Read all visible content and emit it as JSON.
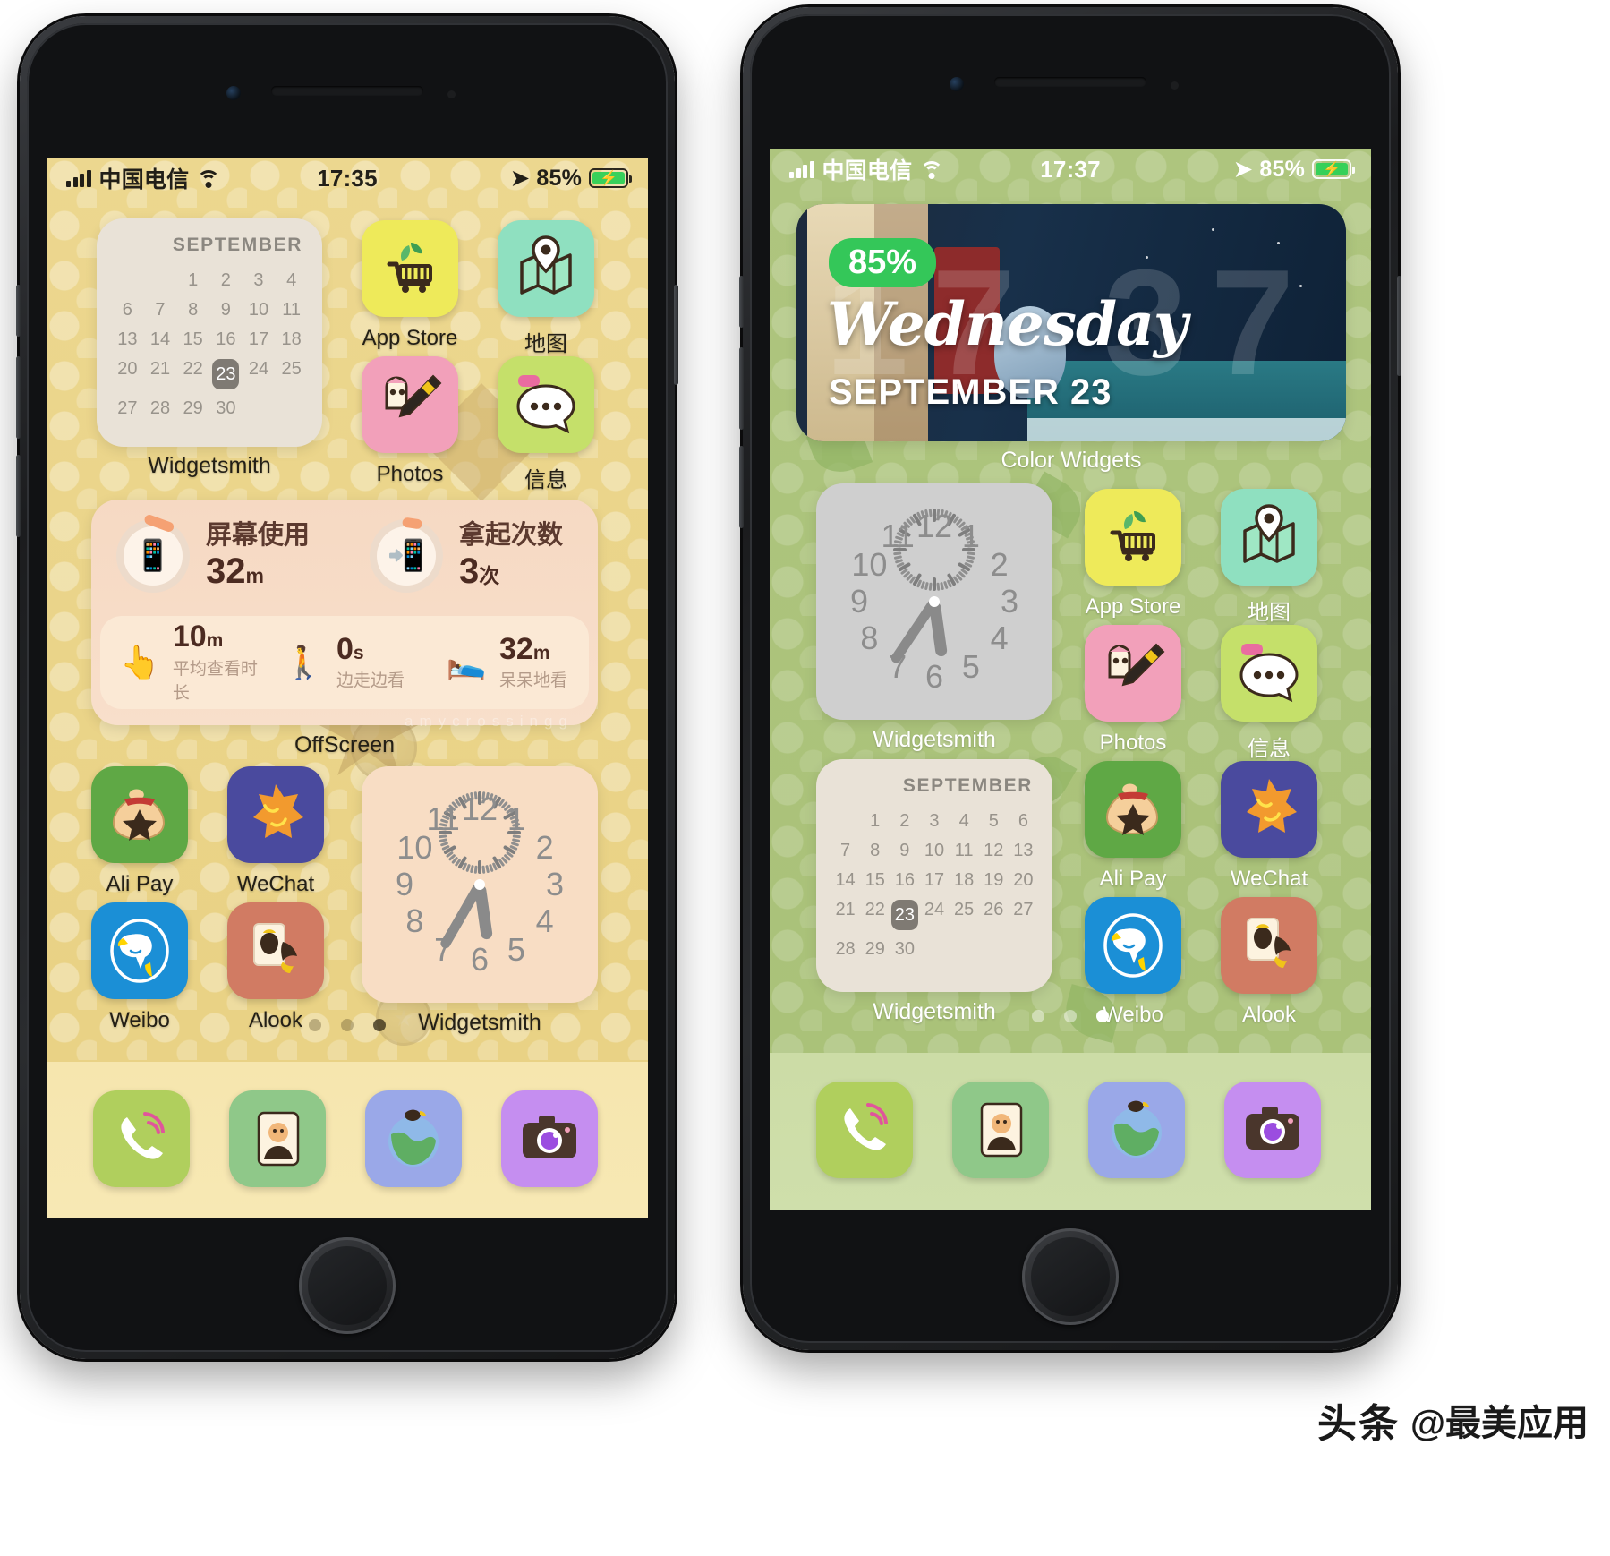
{
  "left_phone": {
    "status_bar": {
      "carrier": "中国电信",
      "time": "17:35",
      "battery_percent": "85%",
      "signal_icon": "signal-bars-icon",
      "wifi_icon": "wifi-icon",
      "location_icon": "location-arrow-icon",
      "battery_icon": "battery-charging-icon"
    },
    "calendar_widget": {
      "month": "SEPTEMBER",
      "days": [
        "",
        "",
        "1",
        "2",
        "3",
        "4",
        "6",
        "7",
        "8",
        "9",
        "10",
        "11",
        "13",
        "14",
        "15",
        "16",
        "17",
        "18",
        "20",
        "21",
        "22",
        "23",
        "24",
        "25",
        "27",
        "28",
        "29",
        "30",
        "",
        ""
      ],
      "today": "23",
      "label": "Widgetsmith"
    },
    "offscreen_widget": {
      "label": "OffScreen",
      "top_stats": [
        {
          "icon": "phone-clock-icon",
          "title": "屏幕使用",
          "value": "32",
          "unit": "m"
        },
        {
          "icon": "hand-phone-icon",
          "title": "拿起次数",
          "value": "3",
          "unit": "次"
        }
      ],
      "bottom_stats": [
        {
          "icon": "swipe-icon",
          "value": "10",
          "unit": "m",
          "sub": "平均查看时长"
        },
        {
          "icon": "walking-phone-icon",
          "value": "0",
          "unit": "s",
          "sub": "边走边看"
        },
        {
          "icon": "lying-phone-icon",
          "value": "32",
          "unit": "m",
          "sub": "呆呆地看"
        }
      ]
    },
    "clock_widget": {
      "label": "Widgetsmith",
      "numerals": [
        "12",
        "1",
        "2",
        "3",
        "4",
        "5",
        "6",
        "7",
        "8",
        "9",
        "10",
        "11"
      ],
      "hour_angle": 172,
      "minute_angle": 210
    },
    "apps_row1": [
      {
        "name": "App Store",
        "icon": "appstore-cart-icon"
      },
      {
        "name": "地图",
        "icon": "maps-pin-icon"
      }
    ],
    "apps_row2": [
      {
        "name": "Photos",
        "icon": "photos-pencil-icon"
      },
      {
        "name": "信息",
        "icon": "messages-bubble-icon"
      }
    ],
    "apps_row3": [
      {
        "name": "Ali Pay",
        "icon": "alipay-moneybag-icon"
      },
      {
        "name": "WeChat",
        "icon": "wechat-star-icon"
      }
    ],
    "apps_row4": [
      {
        "name": "Weibo",
        "icon": "weibo-bird-icon"
      },
      {
        "name": "Alook",
        "icon": "alook-card-icon"
      }
    ],
    "dock": [
      {
        "name": "phone",
        "icon": "phone-handset-icon"
      },
      {
        "name": "contacts",
        "icon": "contacts-book-icon"
      },
      {
        "name": "safari",
        "icon": "safari-globe-icon"
      },
      {
        "name": "camera",
        "icon": "camera-icon"
      }
    ],
    "page_dots": {
      "count": 3,
      "active_index": 2
    }
  },
  "right_phone": {
    "status_bar": {
      "carrier": "中国电信",
      "time": "17:37",
      "battery_percent": "85%",
      "signal_icon": "signal-bars-icon",
      "wifi_icon": "wifi-icon",
      "location_icon": "location-arrow-icon",
      "battery_icon": "battery-charging-icon"
    },
    "color_widget": {
      "battery_badge": "85%",
      "weekday": "Wednesday",
      "date": "SEPTEMBER 23",
      "background_time": "17 37",
      "label": "Color Widgets"
    },
    "clock_widget": {
      "label": "Widgetsmith",
      "numerals": [
        "12",
        "1",
        "2",
        "3",
        "4",
        "5",
        "6",
        "7",
        "8",
        "9",
        "10",
        "11"
      ],
      "hour_angle": 172,
      "minute_angle": 214
    },
    "calendar_widget": {
      "month": "SEPTEMBER",
      "days": [
        "",
        "1",
        "2",
        "3",
        "4",
        "5",
        "6",
        "7",
        "8",
        "9",
        "10",
        "11",
        "12",
        "13",
        "14",
        "15",
        "16",
        "17",
        "18",
        "19",
        "20",
        "21",
        "22",
        "23",
        "24",
        "25",
        "26",
        "27",
        "28",
        "29",
        "30",
        "",
        "",
        ""
      ],
      "today": "23",
      "label": "Widgetsmith"
    },
    "apps_row1": [
      {
        "name": "App Store",
        "icon": "appstore-cart-icon"
      },
      {
        "name": "地图",
        "icon": "maps-pin-icon"
      }
    ],
    "apps_row2": [
      {
        "name": "Photos",
        "icon": "photos-pencil-icon"
      },
      {
        "name": "信息",
        "icon": "messages-bubble-icon"
      }
    ],
    "apps_row3": [
      {
        "name": "Ali Pay",
        "icon": "alipay-moneybag-icon"
      },
      {
        "name": "WeChat",
        "icon": "wechat-star-icon"
      }
    ],
    "apps_row4": [
      {
        "name": "Weibo",
        "icon": "weibo-bird-icon"
      },
      {
        "name": "Alook",
        "icon": "alook-card-icon"
      }
    ],
    "dock": [
      {
        "name": "phone",
        "icon": "phone-handset-icon"
      },
      {
        "name": "contacts",
        "icon": "contacts-book-icon"
      },
      {
        "name": "safari",
        "icon": "safari-globe-icon"
      },
      {
        "name": "camera",
        "icon": "camera-icon"
      }
    ],
    "page_dots": {
      "count": 3,
      "active_index": 2
    }
  },
  "watermark": {
    "logo": "头条",
    "text": "@最美应用"
  },
  "colors": {
    "left_wallpaper": "#e9d285",
    "right_wallpaper": "#a9c178",
    "battery_green": "#34c759",
    "calendar_bg": "#e9e2d7",
    "offscreen_bg": "#f6d9c3"
  }
}
